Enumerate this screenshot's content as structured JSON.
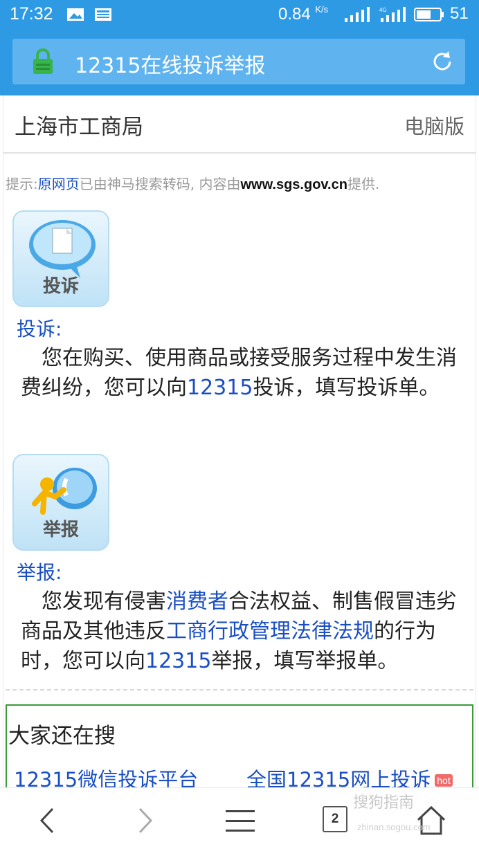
{
  "status_bar": {
    "time": "17:32",
    "net_speed": "0.84",
    "net_unit": "K/s",
    "battery": "51"
  },
  "address_bar": {
    "title": "12315在线投诉举报"
  },
  "site": {
    "title": "上海市工商局",
    "desktop_link": "电脑版"
  },
  "hint": {
    "prefix": "提示:",
    "link": "原网页",
    "middle": "已由神马搜索转码, 内容由",
    "domain": "www.sgs.gov.cn",
    "suffix": "提供."
  },
  "complaint": {
    "icon_label": "投诉",
    "title": "投诉:",
    "text_1": "您在购买、使用商品或接受服务过程中发生消费纠纷，您可以向",
    "link": "12315",
    "text_2": "投诉，填写投诉单。"
  },
  "report": {
    "icon_label": "举报",
    "title": "举报:",
    "text_1": "您发现有侵害",
    "link_1": "消费者",
    "text_2": "合法权益、制售假冒违劣商品及其他违反",
    "link_2": "工商行政管理法律法规",
    "text_3": "的行为时，您可以向",
    "link_3": "12315",
    "text_4": "举报，填写举报单。"
  },
  "search": {
    "title": "大家还在搜",
    "items": [
      {
        "label": "12315微信投诉平台"
      },
      {
        "label": "全国12315网上投诉",
        "badge": "hot"
      }
    ]
  },
  "toolbar": {
    "tab_count": "2"
  },
  "watermark": {
    "text": "搜狗指南",
    "sub": "zhinan.sogou.com"
  },
  "colors": {
    "status_bg": "#2e9ae4",
    "address_box": "#5fb3ef",
    "link_blue": "#1a4fc4",
    "lock_green": "#37b44a",
    "search_border": "#3c9a3c",
    "hot_badge": "#f06a6a"
  }
}
